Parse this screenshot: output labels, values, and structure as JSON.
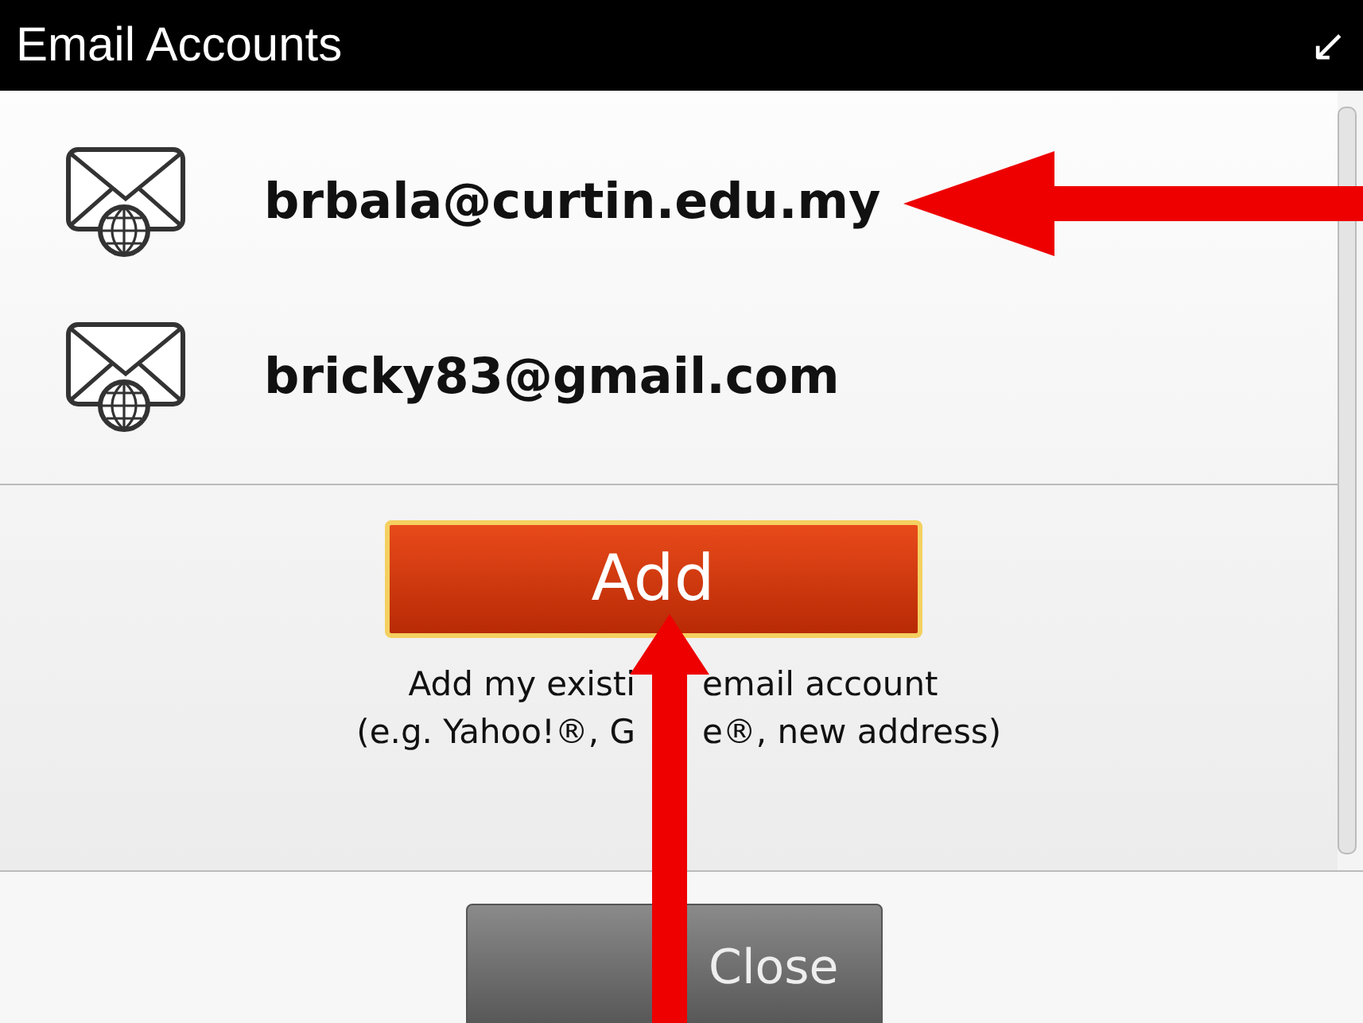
{
  "header": {
    "title": "Email Accounts",
    "corner_icon": "↙"
  },
  "accounts": [
    {
      "address": "brbala@curtin.edu.my"
    },
    {
      "address": "bricky83@gmail.com"
    }
  ],
  "add_button": {
    "label": "Add"
  },
  "hint": [
    [
      "Add my existi",
      "email account"
    ],
    [
      "(e.g. Yahoo!®, G",
      "e®, new address)"
    ]
  ],
  "close_button": {
    "label": "Close"
  },
  "annotations": [
    {
      "kind": "left"
    },
    {
      "kind": "up"
    }
  ]
}
